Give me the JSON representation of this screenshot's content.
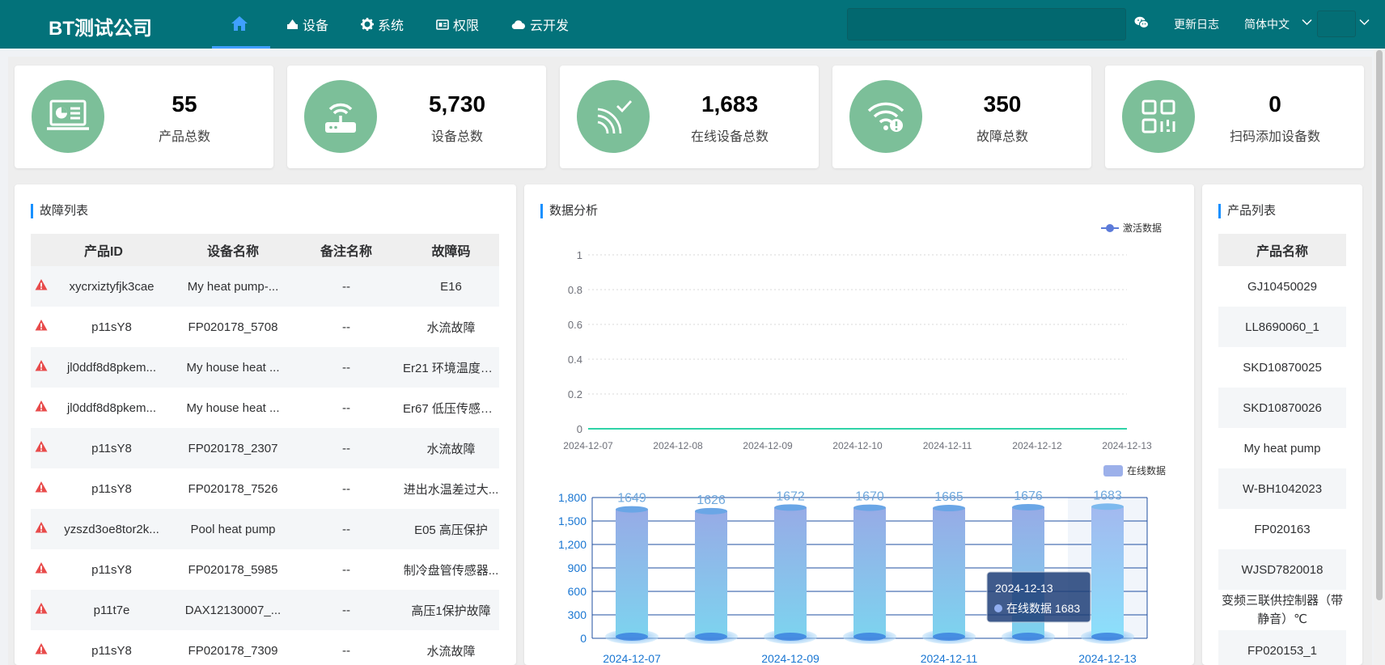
{
  "header": {
    "brand": "BT测试公司",
    "nav": [
      {
        "label": "设备",
        "icon": "tenant-icon"
      },
      {
        "label": "系统",
        "icon": "gear-icon"
      },
      {
        "label": "权限",
        "icon": "id-card-icon"
      },
      {
        "label": "云开发",
        "icon": "cloud-icon"
      }
    ],
    "changelog": "更新日志",
    "language": "简体中文"
  },
  "stats": [
    {
      "value": "55",
      "label": "产品总数",
      "icon": "product-board-icon"
    },
    {
      "value": "5,730",
      "label": "设备总数",
      "icon": "router-icon"
    },
    {
      "value": "1,683",
      "label": "在线设备总数",
      "icon": "signal-check-icon"
    },
    {
      "value": "350",
      "label": "故障总数",
      "icon": "wifi-warning-icon"
    },
    {
      "value": "0",
      "label": "扫码添加设备数",
      "icon": "qr-code-icon"
    }
  ],
  "fault_list": {
    "title": "故障列表",
    "columns": [
      "产品ID",
      "设备名称",
      "备注名称",
      "故障码"
    ],
    "rows": [
      [
        "xycrxiztyfjk3cae",
        "My heat pump-...",
        "--",
        "E16"
      ],
      [
        "p11sY8",
        "FP020178_5708",
        "--",
        "水流故障"
      ],
      [
        "jl0ddf8d8pkem...",
        "My house heat ...",
        "--",
        "Er21 环境温度故..."
      ],
      [
        "jl0ddf8d8pkem...",
        "My house heat ...",
        "--",
        "Er67 低压传感器..."
      ],
      [
        "p11sY8",
        "FP020178_2307",
        "--",
        "水流故障"
      ],
      [
        "p11sY8",
        "FP020178_7526",
        "--",
        "进出水温差过大..."
      ],
      [
        "yzszd3oe8tor2k...",
        "Pool heat pump",
        "--",
        "E05 高压保护"
      ],
      [
        "p11sY8",
        "FP020178_5985",
        "--",
        "制冷盘管传感器..."
      ],
      [
        "p11t7e",
        "DAX12130007_...",
        "--",
        "高压1保护故障"
      ],
      [
        "p11sY8",
        "FP020178_7309",
        "--",
        "水流故障"
      ]
    ]
  },
  "analysis": {
    "title": "数据分析"
  },
  "chart_data": [
    {
      "type": "line",
      "x": [
        "2024-12-07",
        "2024-12-08",
        "2024-12-09",
        "2024-12-10",
        "2024-12-11",
        "2024-12-12",
        "2024-12-13"
      ],
      "series": [
        {
          "name": "激活数据",
          "values": [
            0,
            0,
            0,
            0,
            0,
            0,
            0
          ]
        }
      ],
      "yticks": [
        "0",
        "0.2",
        "0.4",
        "0.6",
        "0.8",
        "1"
      ],
      "ylim": [
        0,
        1
      ],
      "legend": "top-right",
      "color": "#2fd3a7"
    },
    {
      "type": "bar",
      "categories": [
        "2024-12-07",
        "2024-12-08",
        "2024-12-09",
        "2024-12-10",
        "2024-12-11",
        "2024-12-12",
        "2024-12-13"
      ],
      "xtick_labels": [
        "2024-12-07",
        "2024-12-09",
        "2024-12-11",
        "2024-12-13"
      ],
      "series": [
        {
          "name": "在线数据",
          "values": [
            1649,
            1626,
            1672,
            1670,
            1665,
            1676,
            1683
          ]
        }
      ],
      "yticks": [
        "0",
        "300",
        "600",
        "900",
        "1,200",
        "1,500",
        "1,800"
      ],
      "ylim": [
        0,
        1800
      ],
      "legend": "top-right",
      "tooltip": {
        "title": "2024-12-13",
        "series": "在线数据",
        "value": "1683"
      },
      "color": "#8fb0e8"
    }
  ],
  "product_list": {
    "title": "产品列表",
    "column": "产品名称",
    "rows": [
      "GJ10450029",
      "LL8690060_1",
      "SKD10870025",
      "SKD10870026",
      "My heat pump",
      "W-BH1042023",
      "FP020163",
      "WJSD7820018",
      "变频三联供控制器（带静音）℃",
      "FP020153_1"
    ]
  }
}
